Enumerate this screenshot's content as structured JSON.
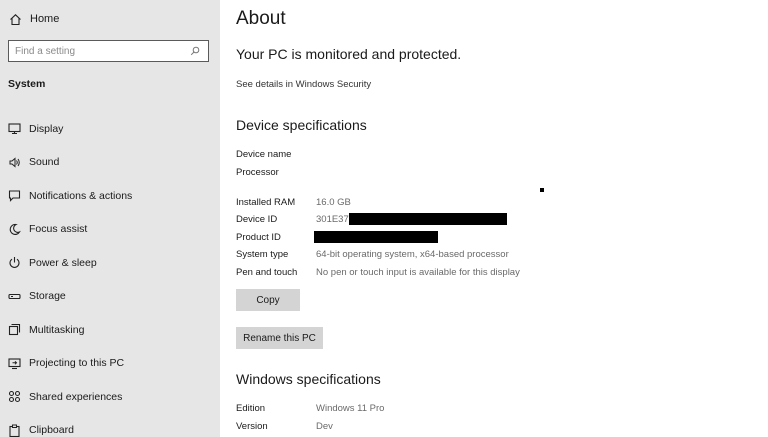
{
  "sidebar": {
    "home_label": "Home",
    "home_icon": "home-icon",
    "search_placeholder": "Find a setting",
    "search_icon": "search-icon",
    "section_label": "System",
    "items": [
      {
        "label": "Display",
        "icon": "display-icon"
      },
      {
        "label": "Sound",
        "icon": "speaker-icon"
      },
      {
        "label": "Notifications & actions",
        "icon": "notifications-icon"
      },
      {
        "label": "Focus assist",
        "icon": "moon-icon"
      },
      {
        "label": "Power & sleep",
        "icon": "power-icon"
      },
      {
        "label": "Storage",
        "icon": "storage-icon"
      },
      {
        "label": "Multitasking",
        "icon": "multitasking-icon"
      },
      {
        "label": "Projecting to this PC",
        "icon": "projecting-icon"
      },
      {
        "label": "Shared experiences",
        "icon": "shared-experiences-icon"
      },
      {
        "label": "Clipboard",
        "icon": "clipboard-icon"
      }
    ]
  },
  "main": {
    "title": "About",
    "protection_heading": "Your PC is monitored and protected.",
    "security_link": "See details in Windows Security",
    "device_heading": "Device specifications",
    "device_specs": [
      {
        "label": "Device name",
        "value": ""
      },
      {
        "label": "Processor",
        "value": ""
      },
      {
        "label": "Installed RAM",
        "value": "16.0 GB"
      },
      {
        "label": "Device ID",
        "value": "301E37"
      },
      {
        "label": "Product ID",
        "value": ""
      },
      {
        "label": "System type",
        "value": "64-bit operating system, x64-based processor"
      },
      {
        "label": "Pen and touch",
        "value": "No pen or touch input is available for this display"
      }
    ],
    "copy_button": "Copy",
    "rename_button": "Rename this PC",
    "windows_heading": "Windows specifications",
    "windows_specs": [
      {
        "label": "Edition",
        "value": "Windows 11 Pro"
      },
      {
        "label": "Version",
        "value": "Dev"
      }
    ]
  }
}
